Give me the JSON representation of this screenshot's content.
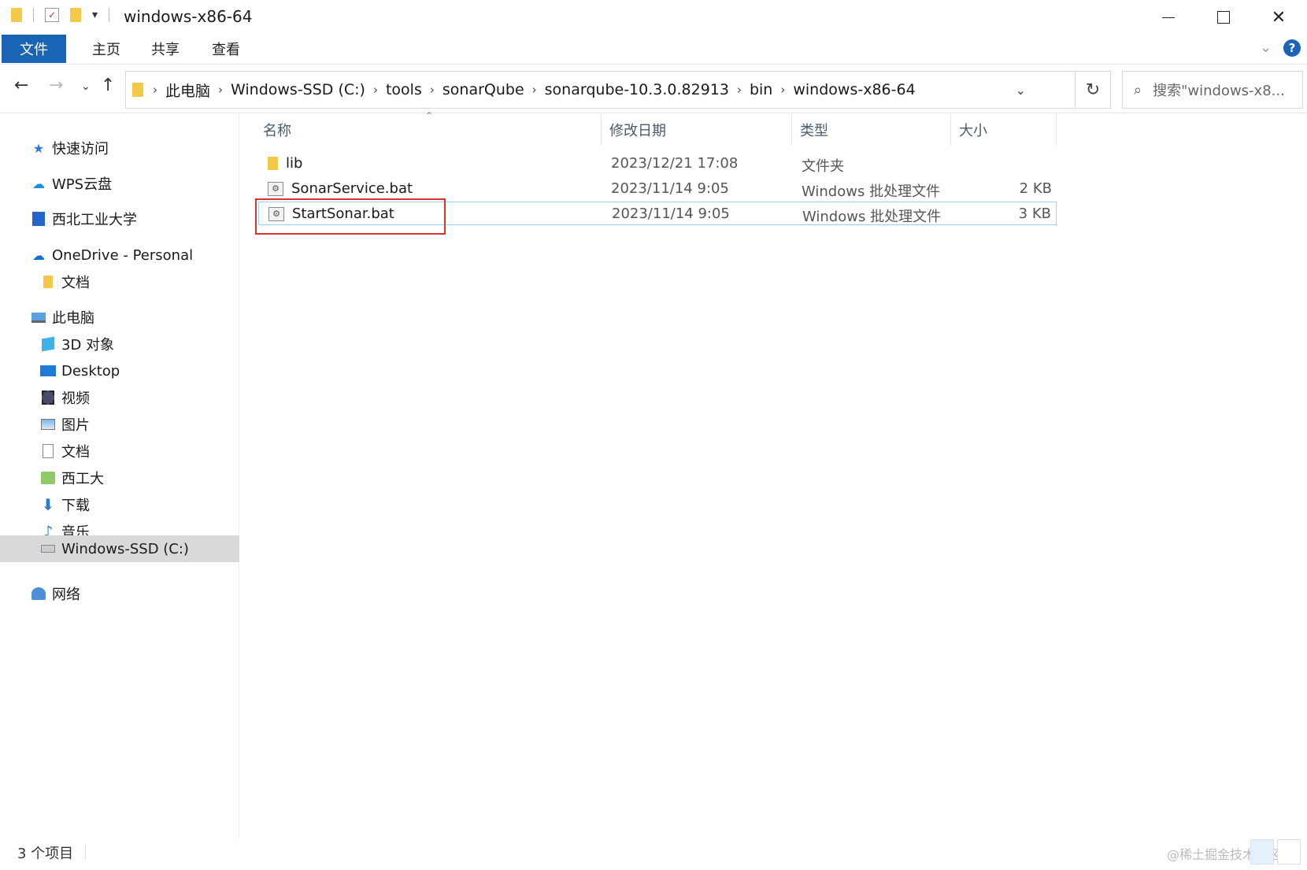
{
  "window": {
    "title": "windows-x86-64"
  },
  "ribbon": {
    "tabs": [
      "文件",
      "主页",
      "共享",
      "查看"
    ]
  },
  "address": {
    "crumbs": [
      "此电脑",
      "Windows-SSD (C:)",
      "tools",
      "sonarQube",
      "sonarqube-10.3.0.82913",
      "bin",
      "windows-x86-64"
    ]
  },
  "search": {
    "placeholder": "搜索\"windows-x8..."
  },
  "sidebar": {
    "items": [
      {
        "label": "快速访问",
        "icon": "star-icon"
      },
      {
        "label": "WPS云盘",
        "icon": "cloud-icon"
      },
      {
        "label": "西北工业大学",
        "icon": "building-icon"
      },
      {
        "label": "OneDrive - Personal",
        "icon": "onedrive-icon"
      },
      {
        "label": "文档",
        "icon": "folder-icon"
      },
      {
        "label": "此电脑",
        "icon": "computer-icon"
      },
      {
        "label": "3D 对象",
        "icon": "cube-icon"
      },
      {
        "label": "Desktop",
        "icon": "desktop-icon"
      },
      {
        "label": "视频",
        "icon": "video-icon"
      },
      {
        "label": "图片",
        "icon": "picture-icon"
      },
      {
        "label": "文档",
        "icon": "document-icon"
      },
      {
        "label": "西工大",
        "icon": "network-folder-icon"
      },
      {
        "label": "下载",
        "icon": "download-icon"
      },
      {
        "label": "音乐",
        "icon": "music-icon"
      },
      {
        "label": "Windows-SSD (C:)",
        "icon": "drive-icon"
      },
      {
        "label": "网络",
        "icon": "network-icon"
      }
    ]
  },
  "columns": {
    "name": "名称",
    "date": "修改日期",
    "type": "类型",
    "size": "大小"
  },
  "files": [
    {
      "name": "lib",
      "date": "2023/12/21 17:08",
      "type": "文件夹",
      "size": ""
    },
    {
      "name": "SonarService.bat",
      "date": "2023/11/14 9:05",
      "type": "Windows 批处理文件",
      "size": "2 KB"
    },
    {
      "name": "StartSonar.bat",
      "date": "2023/11/14 9:05",
      "type": "Windows 批处理文件",
      "size": "3 KB"
    }
  ],
  "status": {
    "count": "3 个项目"
  },
  "watermark": "@稀土掘金技术社区"
}
